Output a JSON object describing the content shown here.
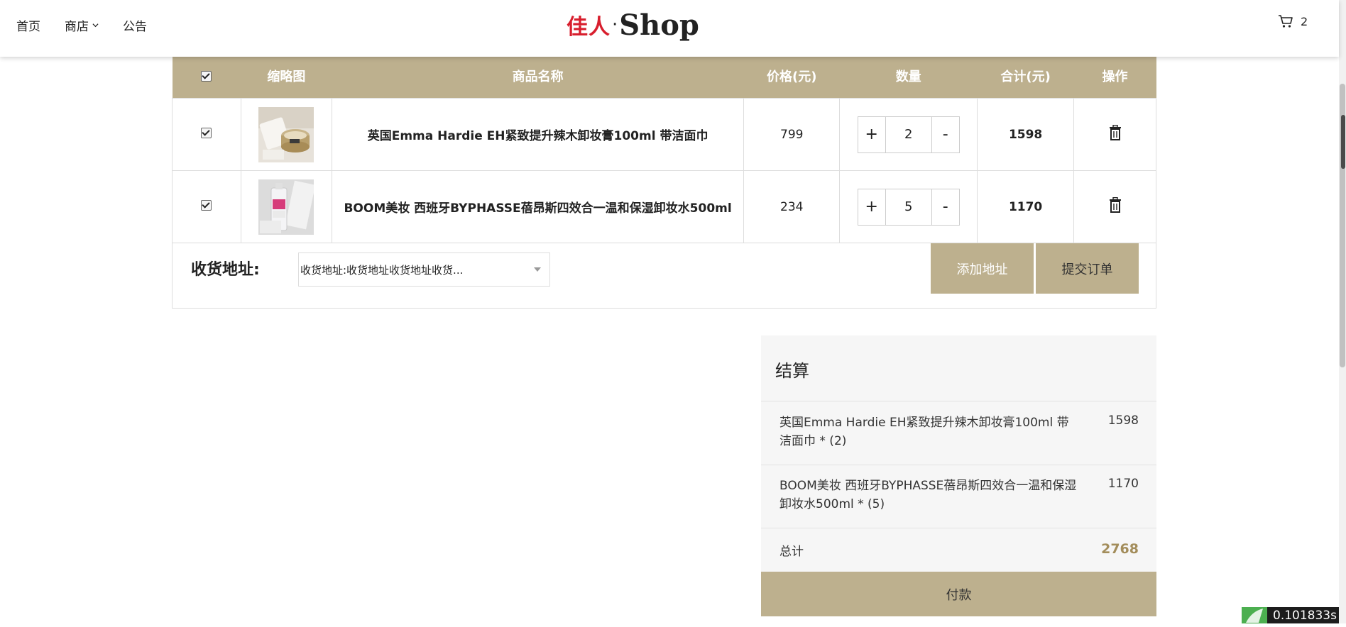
{
  "header": {
    "nav": [
      {
        "label": "首页"
      },
      {
        "label": "商店"
      },
      {
        "label": "公告"
      }
    ],
    "logo_cn": "佳人",
    "logo_dot": "·",
    "logo_en": "Shop",
    "cart_count": "2"
  },
  "table": {
    "columns": {
      "thumbnail": "缩略图",
      "name": "商品名称",
      "price": "价格(元)",
      "quantity": "数量",
      "subtotal": "合计(元)",
      "action": "操作"
    },
    "rows": [
      {
        "name": "英国Emma Hardie EH紧致提升辣木卸妆膏100ml 带洁面巾",
        "price": "799",
        "qty": "2",
        "subtotal": "1598",
        "checked": true
      },
      {
        "name": "BOOM美妆 西班牙BYPHASSE蓓昂斯四效合一温和保湿卸妆水500ml",
        "price": "234",
        "qty": "5",
        "subtotal": "1170",
        "checked": true
      }
    ],
    "plus_label": "+",
    "minus_label": "-"
  },
  "address": {
    "label": "收货地址:",
    "selected": "收货地址:收货地址收货地址收货...",
    "add_button": "添加地址",
    "submit_button": "提交订单"
  },
  "summary": {
    "title": "结算",
    "items": [
      {
        "text": "英国Emma Hardie EH紧致提升辣木卸妆膏100ml 带洁面巾 * (2)",
        "amount": "1598"
      },
      {
        "text": "BOOM美妆 西班牙BYPHASSE蓓昂斯四效合一温和保湿卸妆水500ml * (5)",
        "amount": "1170"
      }
    ],
    "total_label": "总计",
    "total": "2768",
    "pay_button": "付款"
  },
  "timer": "0.101833s",
  "colors": {
    "accent": "#bdb08e",
    "brand_red": "#d81e2d",
    "total": "#a38d5b"
  },
  "icons": [
    "chevron-down-icon",
    "cart-icon",
    "trash-icon",
    "checkbox-icon"
  ]
}
